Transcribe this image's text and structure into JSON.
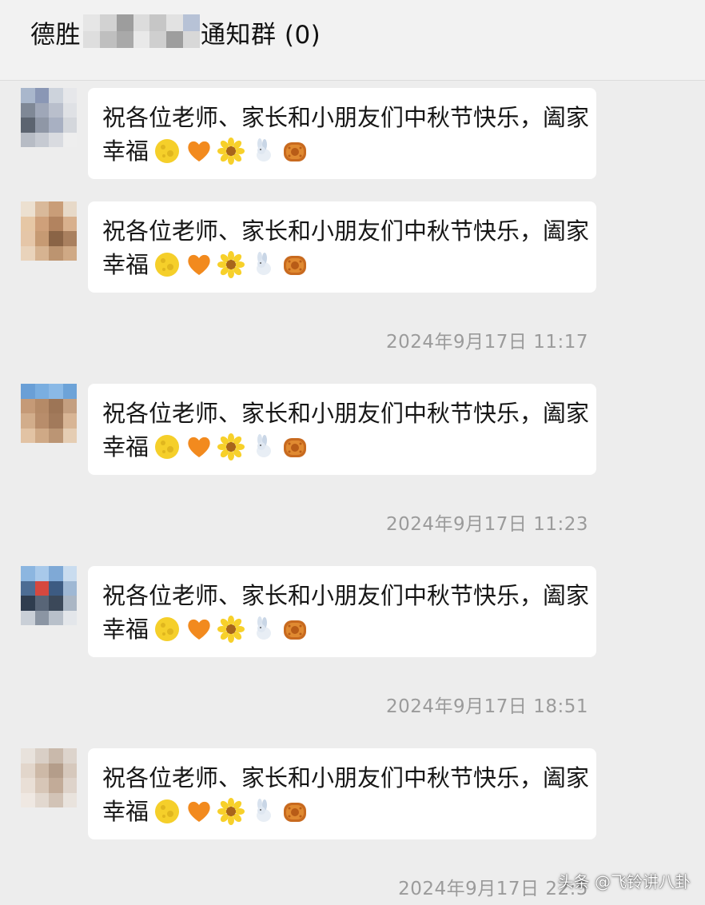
{
  "header": {
    "title_prefix": "德胜",
    "title_suffix": "通知群 (0)"
  },
  "message_text_line1": "祝各位老师、家长和小朋友们中秋节快乐，阖家",
  "message_text_line2": "幸福",
  "emojis": [
    "full-moon-icon",
    "orange-heart-icon",
    "sunflower-icon",
    "jade-rabbit-icon",
    "mooncake-icon"
  ],
  "timestamps": [
    "2024年9月17日 11:17",
    "2024年9月17日 11:23",
    "2024年9月17日 18:51",
    "2024年9月17日 22:5"
  ],
  "watermark": "头条 @飞铃讲八卦",
  "colors": {
    "background": "#ededed",
    "bubble": "#ffffff",
    "timestamp": "#9b9b9b",
    "text": "#161616"
  }
}
